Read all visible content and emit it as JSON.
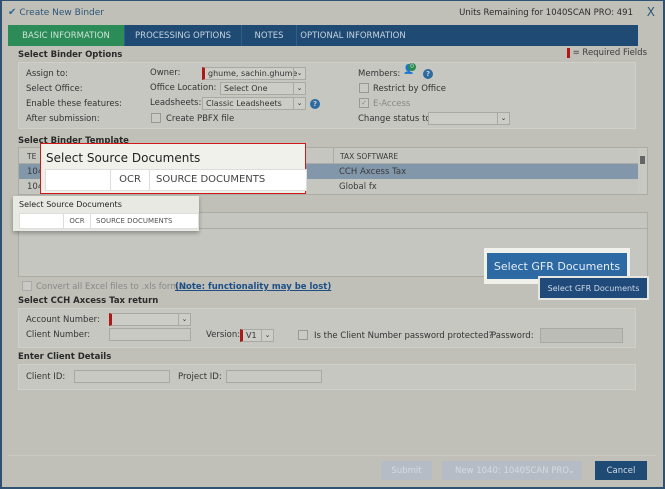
{
  "window": {
    "title": "Create New Binder",
    "units_remaining": "Units Remaining for 1040SCAN PRO: 491",
    "close": "X"
  },
  "tabs": [
    {
      "label": "BASIC INFORMATION",
      "active": true
    },
    {
      "label": "PROCESSING OPTIONS"
    },
    {
      "label": "NOTES"
    },
    {
      "label": "OPTIONAL INFORMATION"
    }
  ],
  "binder_options": {
    "heading": "Select Binder Options",
    "required_legend": "= Required Fields",
    "assign_to": "Assign to:",
    "owner_label": "Owner:",
    "owner_value": "ghume, sachin.ghume",
    "members_label": "Members:",
    "members_count": "0",
    "select_office": "Select Office:",
    "office_location_label": "Office Location:",
    "office_location_value": "Select One",
    "restrict_by_office": "Restrict by Office",
    "enable_features": "Enable these features:",
    "leadsheets_label": "Leadsheets:",
    "leadsheets_value": "Classic Leadsheets",
    "e_access": "E-Access",
    "after_submission": "After submission:",
    "create_pbfx": "Create PBFX file",
    "change_status": "Change status to:"
  },
  "template": {
    "heading": "Select Binder Template",
    "col_template": "TE",
    "col_tax_software": "TAX SOFTWARE",
    "rows": [
      {
        "template": "104",
        "tax_software": "CCH Axcess Tax",
        "selected": true
      },
      {
        "template": "104",
        "tax_software": "Global fx"
      }
    ]
  },
  "source_docs": {
    "heading": "Select Source Documents",
    "col_ocr": "OCR",
    "col_source": "SOURCE DOCUMENTS"
  },
  "callout": {
    "heading": "Select Source Documents",
    "col_ocr": "OCR",
    "col_source": "SOURCE DOCUMENTS",
    "button": "Select GFR Documents"
  },
  "gfr_button": "Select GFR Documents",
  "convert_excel": "Convert all Excel files to .xls format",
  "convert_note": "(Note: functionality may be lost)",
  "cch": {
    "heading": "Select CCH Axcess Tax return",
    "account_number": "Account Number:",
    "client_number": "Client Number:",
    "version_label": "Version:",
    "version_value": "V1",
    "password_protected": "Is the Client Number password protected?",
    "password_label": "Password:"
  },
  "client": {
    "heading": "Enter Client Details",
    "client_id": "Client ID:",
    "project_id": "Project ID:"
  },
  "footer": {
    "submit": "Submit",
    "new_binder": "New 1040: 1040SCAN PRO",
    "cancel": "Cancel"
  }
}
